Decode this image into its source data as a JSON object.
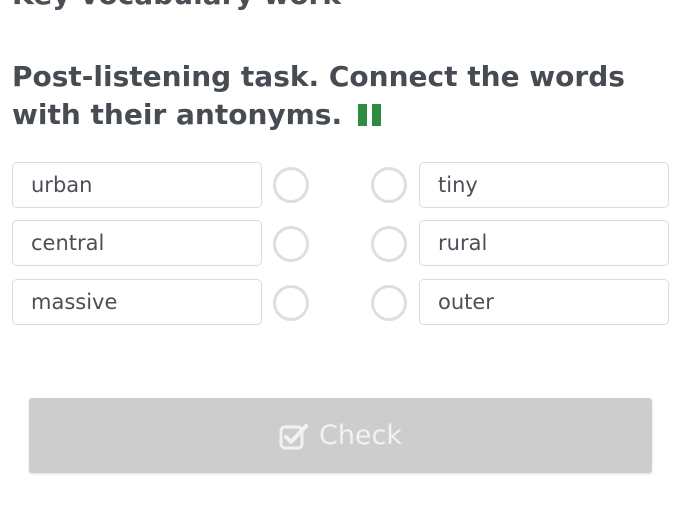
{
  "header": {
    "cutoff_text": "Key vocabulary work"
  },
  "task": {
    "title": "Post-listening task. Connect the words with their antonyms.",
    "audio_icon": "pause-icon"
  },
  "left_words": [
    "urban",
    "central",
    "massive"
  ],
  "right_words": [
    "tiny",
    "rural",
    "outer"
  ],
  "check_button": {
    "label": "Check",
    "icon": "checkbox-check-icon"
  },
  "colors": {
    "pause_icon": "#2e8b3f",
    "button_bg": "#cdcdcd",
    "button_text": "#f2f2f2",
    "circle_border": "#dadfe2",
    "box_border": "#d8dcdf"
  }
}
